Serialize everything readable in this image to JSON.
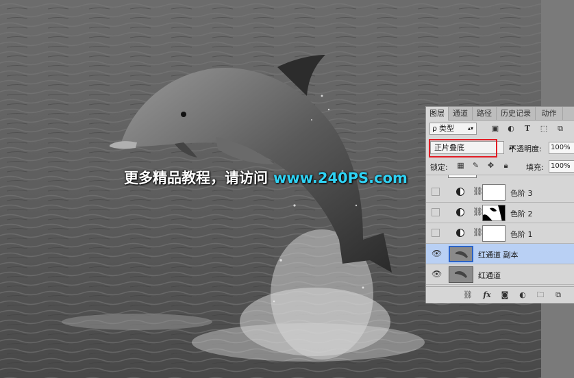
{
  "watermark": {
    "text": "更多精品教程，请访问",
    "url": "www.240PS.com"
  },
  "panel": {
    "tabs": [
      {
        "label": "图层",
        "active": true
      },
      {
        "label": "通道",
        "active": false
      },
      {
        "label": "路径",
        "active": false
      },
      {
        "label": "历史记录",
        "active": false
      },
      {
        "label": "动作",
        "active": false
      }
    ],
    "filter": {
      "symbol": "ρ",
      "label": "类型"
    },
    "filter_icons": [
      "image-icon",
      "adjust-circle-icon",
      "type-T-icon",
      "transform-icon",
      "smart-object-icon"
    ],
    "blend_mode": "正片叠底",
    "opacity_label": "不透明度:",
    "opacity_value": "100%",
    "lock_label": "锁定:",
    "fill_label": "填充:",
    "fill_value": "100%",
    "layers": [
      {
        "name": "色阶 3",
        "visible": false,
        "type": "adjustment",
        "selected": false
      },
      {
        "name": "色阶 2",
        "visible": false,
        "type": "adjustment",
        "selected": false
      },
      {
        "name": "色阶 1",
        "visible": false,
        "type": "adjustment",
        "selected": false
      },
      {
        "name": "红通道 副本",
        "visible": true,
        "type": "image",
        "selected": true
      },
      {
        "name": "红通道",
        "visible": true,
        "type": "image",
        "selected": false
      }
    ],
    "bottom_icons": [
      "link-icon",
      "fx-icon",
      "mask-icon",
      "adjustment-icon",
      "folder-icon",
      "new-layer-icon"
    ],
    "fx_label": "fx"
  },
  "colors": {
    "highlight_box": "#e21c24",
    "selected_layer": "#b9d0f4",
    "watermark_url": "#2fd3f5"
  }
}
